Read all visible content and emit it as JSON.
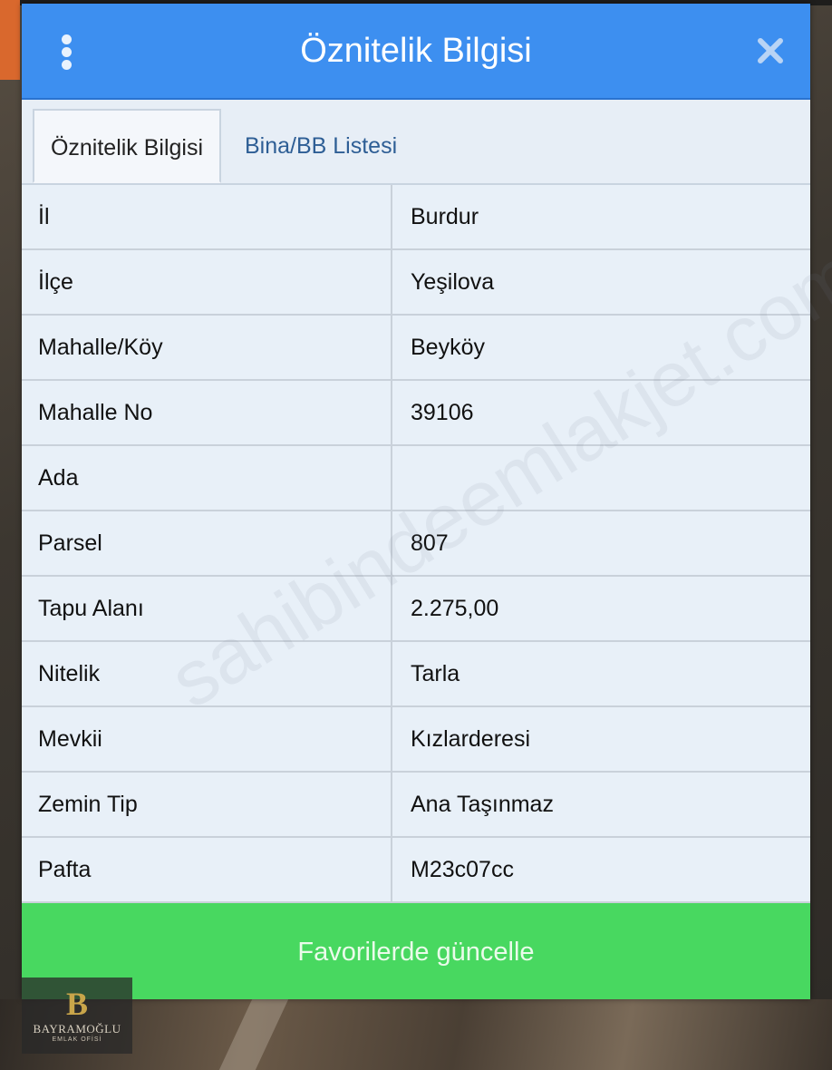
{
  "header": {
    "title": "Öznitelik Bilgisi",
    "menu_icon": "kebab-menu-icon",
    "close_icon": "close-icon"
  },
  "tabs": [
    {
      "label": "Öznitelik Bilgisi",
      "active": true
    },
    {
      "label": "Bina/BB Listesi",
      "active": false
    }
  ],
  "rows": [
    {
      "label": "İl",
      "value": "Burdur"
    },
    {
      "label": "İlçe",
      "value": "Yeşilova"
    },
    {
      "label": "Mahalle/Köy",
      "value": "Beyköy"
    },
    {
      "label": "Mahalle No",
      "value": "39106"
    },
    {
      "label": "Ada",
      "value": ""
    },
    {
      "label": "Parsel",
      "value": "807"
    },
    {
      "label": "Tapu Alanı",
      "value": "2.275,00"
    },
    {
      "label": "Nitelik",
      "value": "Tarla"
    },
    {
      "label": "Mevkii",
      "value": "Kızlarderesi"
    },
    {
      "label": "Zemin Tip",
      "value": "Ana Taşınmaz"
    },
    {
      "label": "Pafta",
      "value": "M23c07cc"
    }
  ],
  "action": {
    "favorite_label": "Favorilerde güncelle"
  },
  "watermark": {
    "text": "sahibindeemlakjet.com"
  },
  "logo": {
    "letter": "B",
    "name": "BAYRAMOĞLU",
    "sub": "EMLAK OFİSİ"
  },
  "colors": {
    "header": "#3d8ff0",
    "button": "#48d860",
    "panel": "#e7eef6"
  }
}
